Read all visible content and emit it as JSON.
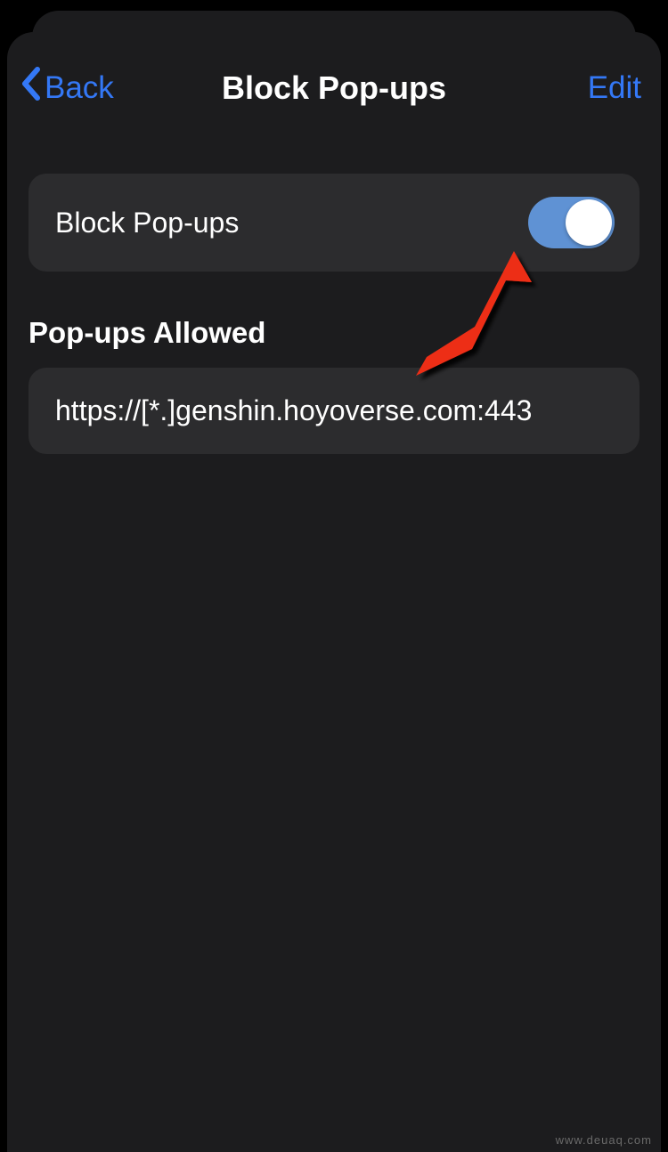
{
  "nav": {
    "back_label": "Back",
    "title": "Block Pop-ups",
    "edit_label": "Edit"
  },
  "toggle_row": {
    "label": "Block Pop-ups",
    "enabled": true
  },
  "allowed_section": {
    "header": "Pop-ups Allowed",
    "items": [
      "https://[*.]genshin.hoyoverse.com:443"
    ]
  },
  "watermark": "www.deuaq.com",
  "colors": {
    "link": "#3478f6",
    "background": "#1c1c1e",
    "cell": "#2c2c2e",
    "toggle_on": "#5f92d4"
  }
}
